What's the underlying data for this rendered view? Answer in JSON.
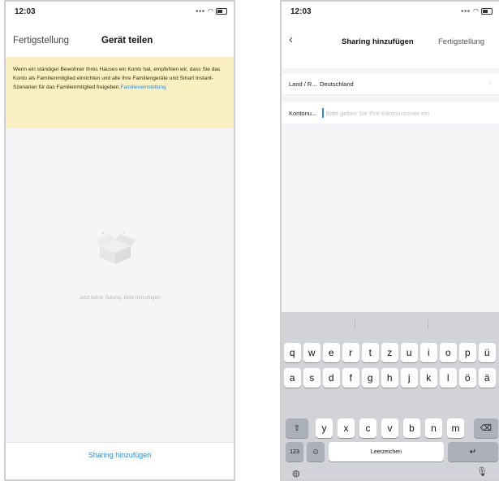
{
  "left_phone": {
    "status": {
      "time": "12:03",
      "icons": "▪▪▪ ◠"
    },
    "nav": {
      "back_label": "Fertigstellung",
      "title": "Gerät teilen"
    },
    "notice": {
      "text": "Wenn ein ständiger Bewohner Ihres Hauses ein Konto hat, empfehlen wir, dass Sie das Konto als Familienmitglied einrichten und alle Ihre Familiengeräte und Smart Instant-Szenarien für das Familienmitglied freigeben.",
      "link": "Familieneinstellung"
    },
    "empty_state": {
      "icon": "open-box-icon",
      "text": "Jetzt keine Teilung. Bitte hinzufügen"
    },
    "footer": {
      "button_label": "Sharing hinzufügen"
    }
  },
  "right_phone": {
    "status": {
      "time": "12:03",
      "icons": "▪▪▪ ◠"
    },
    "nav": {
      "back_icon": "‹",
      "title": "Sharing hinzufügen",
      "done_label": "Fertigstellung"
    },
    "form": {
      "country_label": "Land / R...",
      "country_value": "Deutschland",
      "chevron": "›",
      "account_label": "Kontonu...",
      "account_placeholder": "Bitte geben Sie Ihre Kontonummer ein"
    },
    "keyboard": {
      "row1": [
        "q",
        "w",
        "e",
        "r",
        "t",
        "z",
        "u",
        "i",
        "o",
        "p",
        "ü"
      ],
      "row2": [
        "a",
        "s",
        "d",
        "f",
        "g",
        "h",
        "j",
        "k",
        "l",
        "ö",
        "ä"
      ],
      "row3": [
        "y",
        "x",
        "c",
        "v",
        "b",
        "n",
        "m"
      ],
      "shift": "⇧",
      "backspace": "⌫",
      "numbers": "123",
      "emoji": "☺",
      "space": "Leerzeichen",
      "return": "↵",
      "globe": "◍",
      "mic": "🎙"
    }
  }
}
